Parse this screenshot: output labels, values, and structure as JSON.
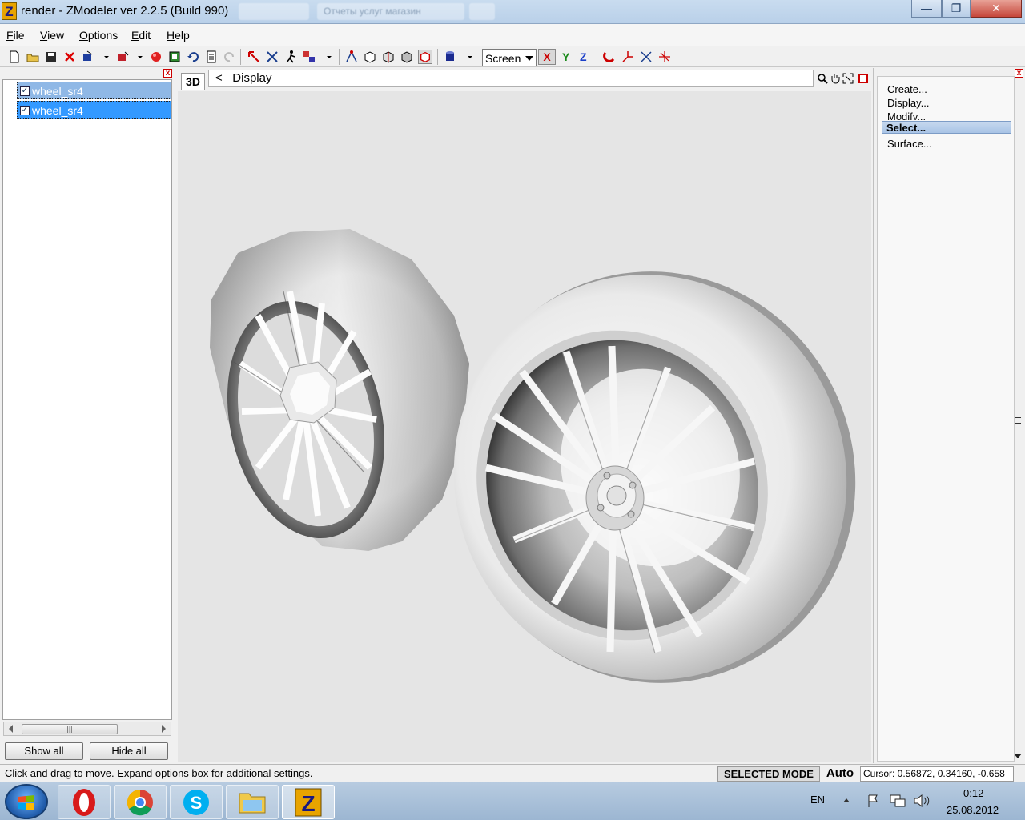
{
  "window": {
    "title": "render - ZModeler ver 2.2.5 (Build 990)",
    "icon_letter": "Z",
    "background_tab": "Отчеты услуг магазин"
  },
  "menu": [
    "File",
    "View",
    "Options",
    "Edit",
    "Help"
  ],
  "toolbar": {
    "screen_select_value": "Screen",
    "axis_x": "X",
    "axis_y": "Y",
    "axis_z": "Z"
  },
  "objects_panel": {
    "items": [
      {
        "label": "wheel_sr4",
        "checked": true
      },
      {
        "label": "wheel_sr4",
        "checked": true
      }
    ],
    "show_all": "Show all",
    "hide_all": "Hide all"
  },
  "viewport": {
    "mode_button": "3D",
    "nav_back": "<",
    "display_label": "Display"
  },
  "command_panel": {
    "items": [
      "Create...",
      "Display...",
      "Modify...",
      "Select...",
      "Surface..."
    ],
    "selected": "Select..."
  },
  "status": {
    "message": "Click and drag to move. Expand options box for additional settings.",
    "mode": "SELECTED MODE",
    "auto": "Auto",
    "cursor": "Cursor: 0.56872, 0.34160, -0.658"
  },
  "taskbar": {
    "lang": "EN",
    "time": "0:12",
    "date": "25.08.2012",
    "apps": [
      "opera-icon",
      "chrome-icon",
      "skype-icon",
      "explorer-icon",
      "zmodeler-icon"
    ]
  },
  "colors": {
    "selection": "#3399ff",
    "viewport_bg": "#e5e5e5",
    "close_red": "#cc0000"
  }
}
